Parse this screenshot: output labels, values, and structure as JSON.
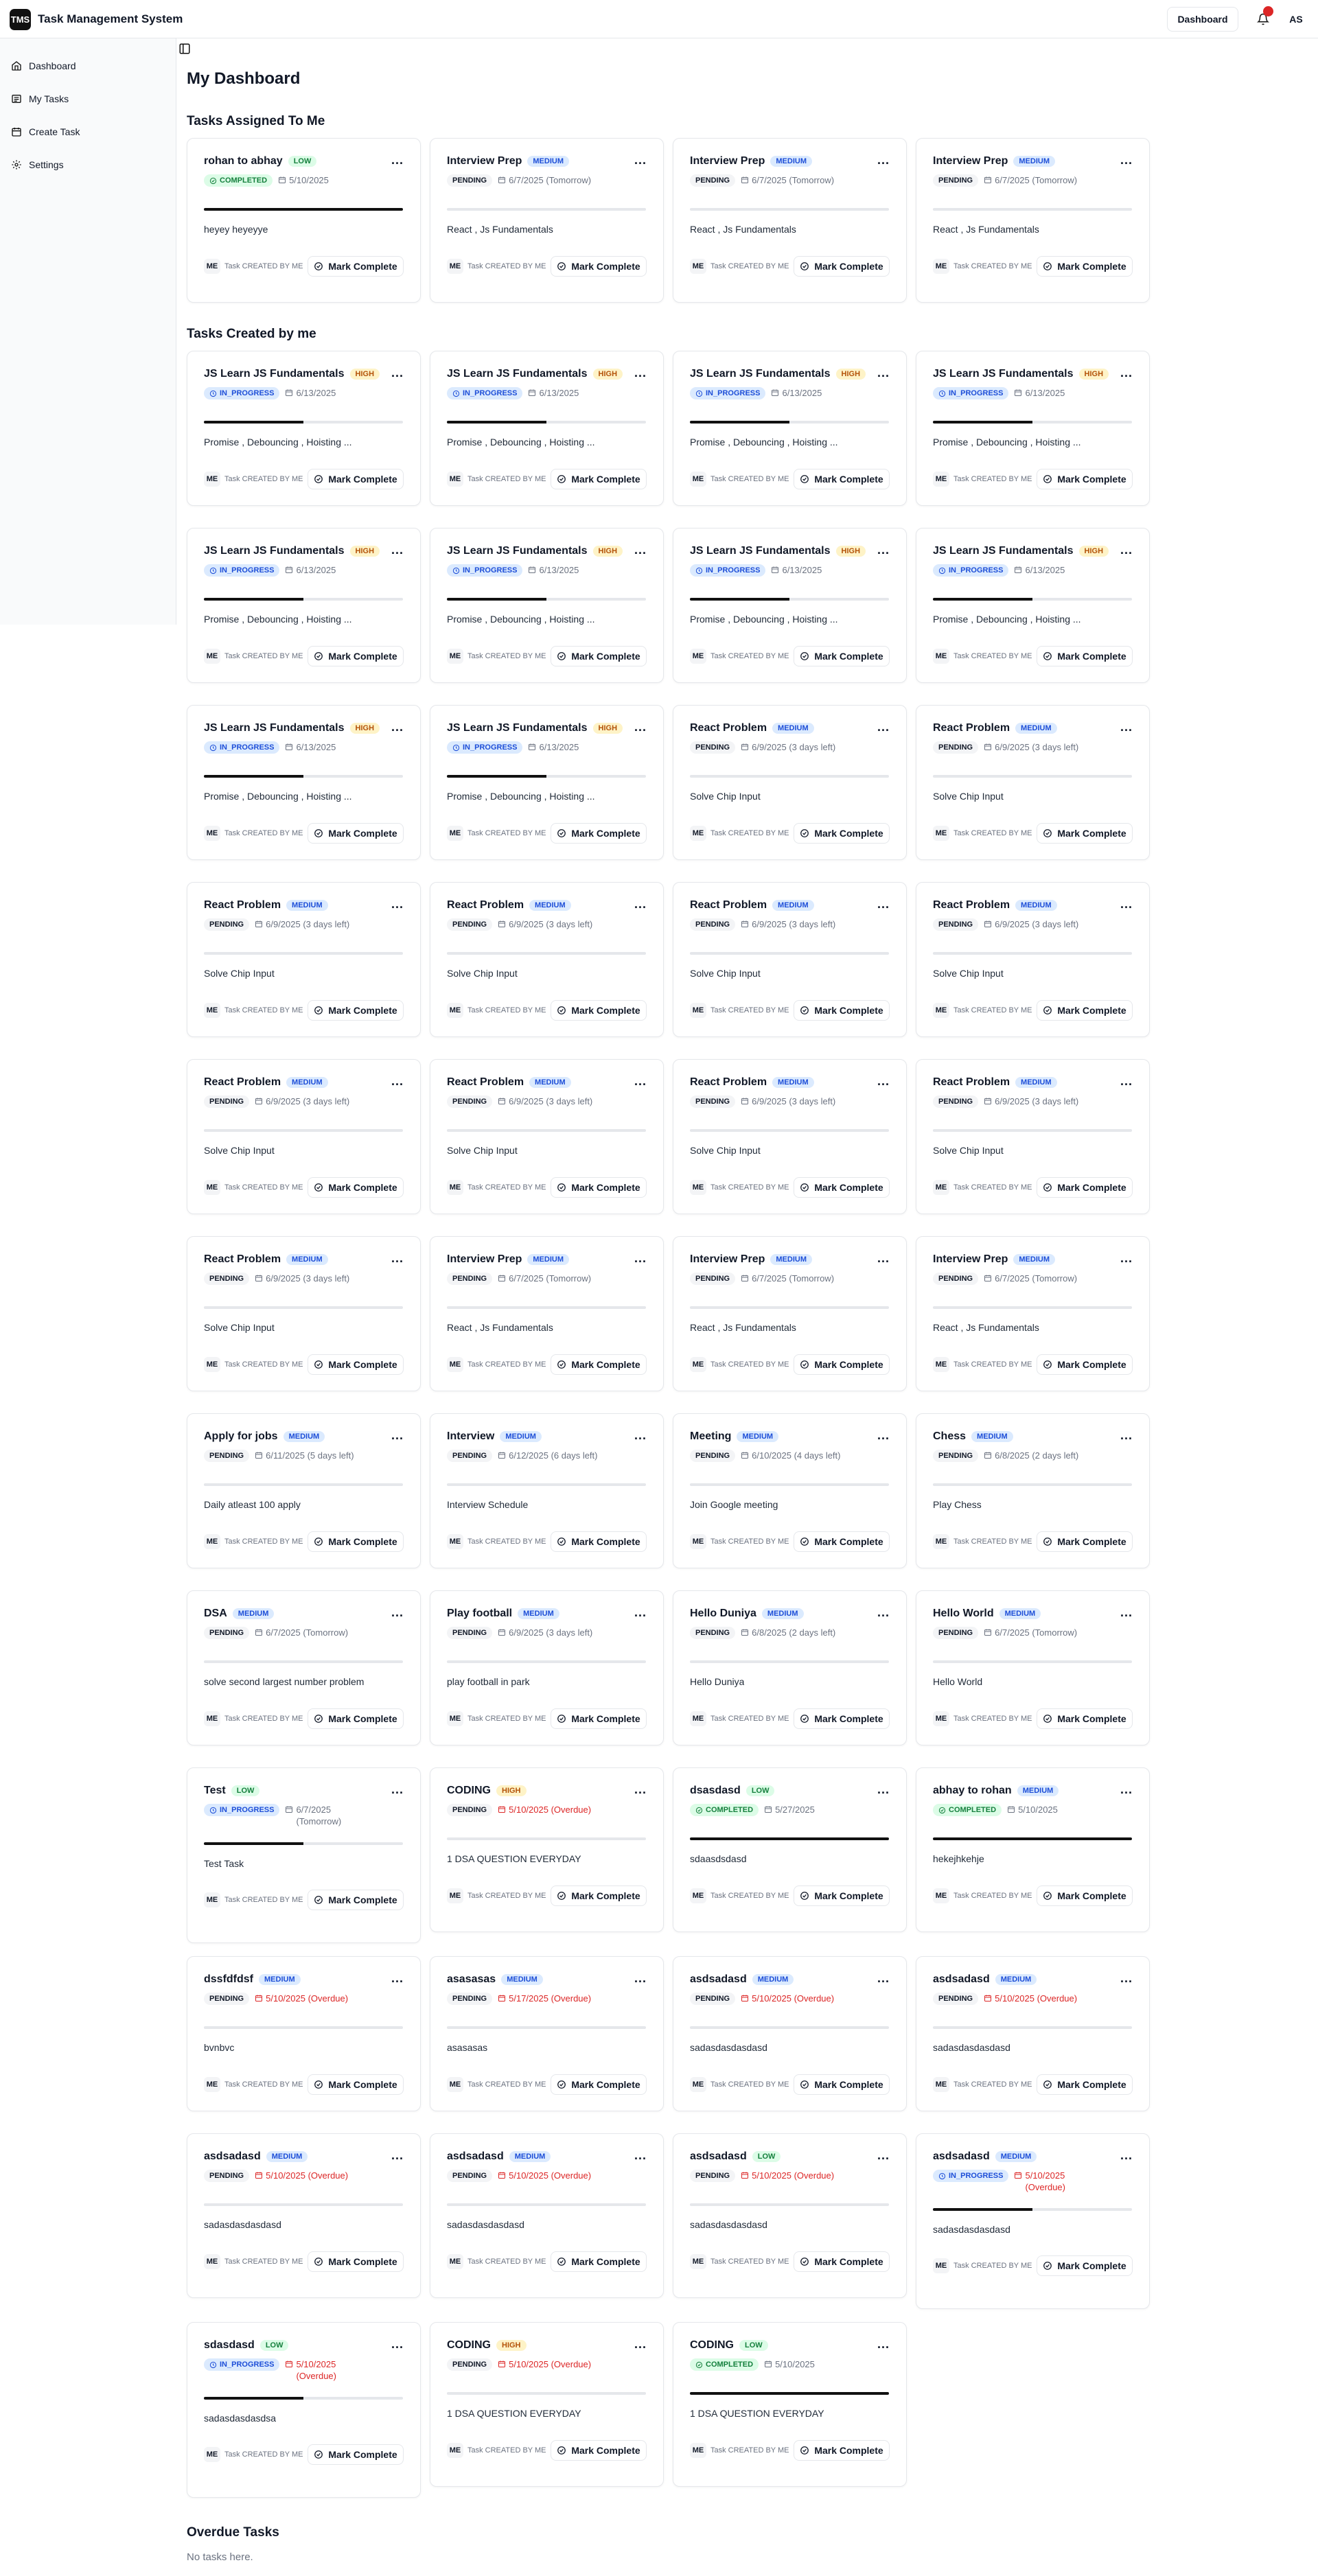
{
  "app": {
    "logo": "TMS",
    "title": "Task Management System"
  },
  "header": {
    "dashboard_label": "Dashboard",
    "avatar": "AS"
  },
  "sidebar": {
    "items": [
      {
        "label": "Dashboard",
        "icon": "home-icon"
      },
      {
        "label": "My Tasks",
        "icon": "list-icon"
      },
      {
        "label": "Create Task",
        "icon": "calendar-icon"
      },
      {
        "label": "Settings",
        "icon": "gear-icon"
      }
    ]
  },
  "page": {
    "title": "My Dashboard",
    "assigned_title": "Tasks Assigned To Me",
    "created_title": "Tasks Created by me",
    "overdue_title": "Overdue Tasks",
    "overdue_empty": "No tasks here."
  },
  "card_common": {
    "me": "ME",
    "created_by": "Task CREATED BY ME",
    "mark_complete": "Mark Complete",
    "menu": "..."
  },
  "colors": {
    "high_bg": "#fef3c7",
    "medium_bg": "#dbeafe",
    "low_bg": "#dcfce7",
    "overdue": "#dc2626",
    "progress": "#111111"
  },
  "assigned": [
    {
      "title": "rohan to abhay",
      "priority": "LOW",
      "status": "COMPLETED",
      "date": "5/10/2025",
      "desc": "heyey heyeyye",
      "progress": 1
    },
    {
      "title": "Interview Prep",
      "priority": "MEDIUM",
      "status": "PENDING",
      "date": "6/7/2025 (Tomorrow)",
      "desc": "React , Js Fundamentals",
      "progress": 0
    },
    {
      "title": "Interview Prep",
      "priority": "MEDIUM",
      "status": "PENDING",
      "date": "6/7/2025 (Tomorrow)",
      "desc": "React , Js Fundamentals",
      "progress": 0
    },
    {
      "title": "Interview Prep",
      "priority": "MEDIUM",
      "status": "PENDING",
      "date": "6/7/2025 (Tomorrow)",
      "desc": "React , Js Fundamentals",
      "progress": 0
    }
  ],
  "created": [
    {
      "title": "JS Learn JS Fundamentals",
      "priority": "HIGH",
      "status": "IN_PROGRESS",
      "date": "6/13/2025",
      "desc": "Promise , Debouncing , Hoisting ...",
      "progress": 0.5
    },
    {
      "title": "JS Learn JS Fundamentals",
      "priority": "HIGH",
      "status": "IN_PROGRESS",
      "date": "6/13/2025",
      "desc": "Promise , Debouncing , Hoisting ...",
      "progress": 0.5
    },
    {
      "title": "JS Learn JS Fundamentals",
      "priority": "HIGH",
      "status": "IN_PROGRESS",
      "date": "6/13/2025",
      "desc": "Promise , Debouncing , Hoisting ...",
      "progress": 0.5
    },
    {
      "title": "JS Learn JS Fundamentals",
      "priority": "HIGH",
      "status": "IN_PROGRESS",
      "date": "6/13/2025",
      "desc": "Promise , Debouncing , Hoisting ...",
      "progress": 0.5
    },
    {
      "title": "JS Learn JS Fundamentals",
      "priority": "HIGH",
      "status": "IN_PROGRESS",
      "date": "6/13/2025",
      "desc": "Promise , Debouncing , Hoisting ...",
      "progress": 0.5
    },
    {
      "title": "JS Learn JS Fundamentals",
      "priority": "HIGH",
      "status": "IN_PROGRESS",
      "date": "6/13/2025",
      "desc": "Promise , Debouncing , Hoisting ...",
      "progress": 0.5
    },
    {
      "title": "JS Learn JS Fundamentals",
      "priority": "HIGH",
      "status": "IN_PROGRESS",
      "date": "6/13/2025",
      "desc": "Promise , Debouncing , Hoisting ...",
      "progress": 0.5
    },
    {
      "title": "JS Learn JS Fundamentals",
      "priority": "HIGH",
      "status": "IN_PROGRESS",
      "date": "6/13/2025",
      "desc": "Promise , Debouncing , Hoisting ...",
      "progress": 0.5
    },
    {
      "title": "JS Learn JS Fundamentals",
      "priority": "HIGH",
      "status": "IN_PROGRESS",
      "date": "6/13/2025",
      "desc": "Promise , Debouncing , Hoisting ...",
      "progress": 0.5
    },
    {
      "title": "JS Learn JS Fundamentals",
      "priority": "HIGH",
      "status": "IN_PROGRESS",
      "date": "6/13/2025",
      "desc": "Promise , Debouncing , Hoisting ...",
      "progress": 0.5
    },
    {
      "title": "React Problem",
      "priority": "MEDIUM",
      "status": "PENDING",
      "date": "6/9/2025 (3 days left)",
      "desc": "Solve Chip Input",
      "progress": 0
    },
    {
      "title": "React Problem",
      "priority": "MEDIUM",
      "status": "PENDING",
      "date": "6/9/2025 (3 days left)",
      "desc": "Solve Chip Input",
      "progress": 0
    },
    {
      "title": "React Problem",
      "priority": "MEDIUM",
      "status": "PENDING",
      "date": "6/9/2025 (3 days left)",
      "desc": "Solve Chip Input",
      "progress": 0
    },
    {
      "title": "React Problem",
      "priority": "MEDIUM",
      "status": "PENDING",
      "date": "6/9/2025 (3 days left)",
      "desc": "Solve Chip Input",
      "progress": 0
    },
    {
      "title": "React Problem",
      "priority": "MEDIUM",
      "status": "PENDING",
      "date": "6/9/2025 (3 days left)",
      "desc": "Solve Chip Input",
      "progress": 0
    },
    {
      "title": "React Problem",
      "priority": "MEDIUM",
      "status": "PENDING",
      "date": "6/9/2025 (3 days left)",
      "desc": "Solve Chip Input",
      "progress": 0
    },
    {
      "title": "React Problem",
      "priority": "MEDIUM",
      "status": "PENDING",
      "date": "6/9/2025 (3 days left)",
      "desc": "Solve Chip Input",
      "progress": 0
    },
    {
      "title": "React Problem",
      "priority": "MEDIUM",
      "status": "PENDING",
      "date": "6/9/2025 (3 days left)",
      "desc": "Solve Chip Input",
      "progress": 0
    },
    {
      "title": "React Problem",
      "priority": "MEDIUM",
      "status": "PENDING",
      "date": "6/9/2025 (3 days left)",
      "desc": "Solve Chip Input",
      "progress": 0
    },
    {
      "title": "React Problem",
      "priority": "MEDIUM",
      "status": "PENDING",
      "date": "6/9/2025 (3 days left)",
      "desc": "Solve Chip Input",
      "progress": 0
    },
    {
      "title": "React Problem",
      "priority": "MEDIUM",
      "status": "PENDING",
      "date": "6/9/2025 (3 days left)",
      "desc": "Solve Chip Input",
      "progress": 0
    },
    {
      "title": "Interview Prep",
      "priority": "MEDIUM",
      "status": "PENDING",
      "date": "6/7/2025 (Tomorrow)",
      "desc": "React , Js Fundamentals",
      "progress": 0
    },
    {
      "title": "Interview Prep",
      "priority": "MEDIUM",
      "status": "PENDING",
      "date": "6/7/2025 (Tomorrow)",
      "desc": "React , Js Fundamentals",
      "progress": 0
    },
    {
      "title": "Interview Prep",
      "priority": "MEDIUM",
      "status": "PENDING",
      "date": "6/7/2025 (Tomorrow)",
      "desc": "React , Js Fundamentals",
      "progress": 0
    },
    {
      "title": "Apply for jobs",
      "priority": "MEDIUM",
      "status": "PENDING",
      "date": "6/11/2025 (5 days left)",
      "desc": "Daily atleast 100 apply",
      "progress": 0
    },
    {
      "title": "Interview",
      "priority": "MEDIUM",
      "status": "PENDING",
      "date": "6/12/2025 (6 days left)",
      "desc": "Interview Schedule",
      "progress": 0
    },
    {
      "title": "Meeting",
      "priority": "MEDIUM",
      "status": "PENDING",
      "date": "6/10/2025 (4 days left)",
      "desc": "Join Google meeting",
      "progress": 0
    },
    {
      "title": "Chess",
      "priority": "MEDIUM",
      "status": "PENDING",
      "date": "6/8/2025 (2 days left)",
      "desc": "Play Chess",
      "progress": 0
    },
    {
      "title": "DSA",
      "priority": "MEDIUM",
      "status": "PENDING",
      "date": "6/7/2025 (Tomorrow)",
      "desc": "solve second largest number problem",
      "progress": 0
    },
    {
      "title": "Play football",
      "priority": "MEDIUM",
      "status": "PENDING",
      "date": "6/9/2025 (3 days left)",
      "desc": "play football in park",
      "progress": 0
    },
    {
      "title": "Hello Duniya",
      "priority": "MEDIUM",
      "status": "PENDING",
      "date": "6/8/2025 (2 days left)",
      "desc": "Hello Duniya",
      "progress": 0
    },
    {
      "title": "Hello World",
      "priority": "MEDIUM",
      "status": "PENDING",
      "date": "6/7/2025 (Tomorrow)",
      "desc": "Hello World",
      "progress": 0
    },
    {
      "title": "Test",
      "priority": "LOW",
      "status": "IN_PROGRESS",
      "date": "6/7/2025",
      "date2": "(Tomorrow)",
      "desc": "Test Task",
      "progress": 0.5
    },
    {
      "title": "CODING",
      "priority": "HIGH",
      "status": "PENDING",
      "date": "5/10/2025 (Overdue)",
      "overdue": true,
      "desc": "1 DSA QUESTION EVERYDAY",
      "progress": 0
    },
    {
      "title": "dsasdasd",
      "priority": "LOW",
      "status": "COMPLETED",
      "date": "5/27/2025",
      "desc": "sdaasdsdasd",
      "progress": 1
    },
    {
      "title": "abhay to rohan",
      "priority": "MEDIUM",
      "status": "COMPLETED",
      "date": "5/10/2025",
      "desc": "hekejhkehje",
      "progress": 1
    },
    {
      "title": "dssfdfdsf",
      "priority": "MEDIUM",
      "status": "PENDING",
      "date": "5/10/2025 (Overdue)",
      "overdue": true,
      "desc": "bvnbvc",
      "progress": 0
    },
    {
      "title": "asasasas",
      "priority": "MEDIUM",
      "status": "PENDING",
      "date": "5/17/2025 (Overdue)",
      "overdue": true,
      "desc": "asasasas",
      "progress": 0
    },
    {
      "title": "asdsadasd",
      "priority": "MEDIUM",
      "status": "PENDING",
      "date": "5/10/2025 (Overdue)",
      "overdue": true,
      "desc": "sadasdasdasdasd",
      "progress": 0
    },
    {
      "title": "asdsadasd",
      "priority": "MEDIUM",
      "status": "PENDING",
      "date": "5/10/2025 (Overdue)",
      "overdue": true,
      "desc": "sadasdasdasdasd",
      "progress": 0
    },
    {
      "title": "asdsadasd",
      "priority": "MEDIUM",
      "status": "PENDING",
      "date": "5/10/2025 (Overdue)",
      "overdue": true,
      "desc": "sadasdasdasdasd",
      "progress": 0
    },
    {
      "title": "asdsadasd",
      "priority": "MEDIUM",
      "status": "PENDING",
      "date": "5/10/2025 (Overdue)",
      "overdue": true,
      "desc": "sadasdasdasdasd",
      "progress": 0
    },
    {
      "title": "asdsadasd",
      "priority": "LOW",
      "status": "PENDING",
      "date": "5/10/2025 (Overdue)",
      "overdue": true,
      "desc": "sadasdasdasdasd",
      "progress": 0
    },
    {
      "title": "asdsadasd",
      "priority": "MEDIUM",
      "status": "IN_PROGRESS",
      "date": "5/10/2025",
      "date2": "(Overdue)",
      "overdue": true,
      "desc": "sadasdasdasdasd",
      "progress": 0.5
    },
    {
      "title": "sdasdasd",
      "priority": "LOW",
      "status": "IN_PROGRESS",
      "date": "5/10/2025",
      "date2": "(Overdue)",
      "overdue": true,
      "desc": "sadasdasdasdsa",
      "progress": 0.5
    },
    {
      "title": "CODING",
      "priority": "HIGH",
      "status": "PENDING",
      "date": "5/10/2025 (Overdue)",
      "overdue": true,
      "desc": "1 DSA QUESTION EVERYDAY",
      "progress": 0
    },
    {
      "title": "CODING",
      "priority": "LOW",
      "status": "COMPLETED",
      "date": "5/10/2025",
      "desc": "1 DSA QUESTION EVERYDAY",
      "progress": 1
    }
  ]
}
